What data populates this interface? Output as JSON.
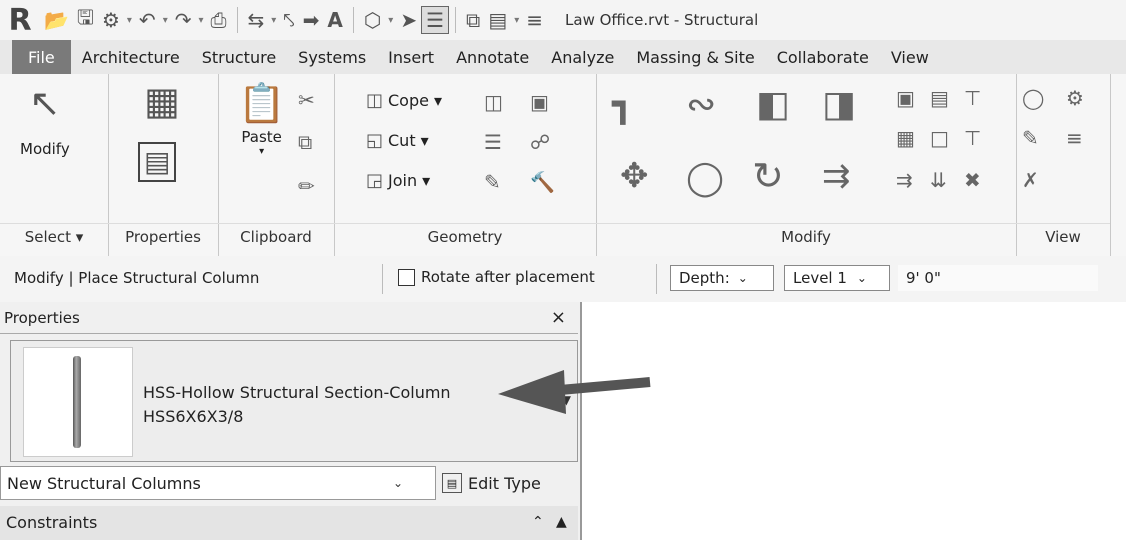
{
  "app": {
    "logo": "R",
    "title": "Law Office.rvt - Structural"
  },
  "qat": {
    "icons": [
      "open-icon",
      "save-icon",
      "sync-icon",
      "undo-icon",
      "redo-icon",
      "print-icon",
      "measure-icon",
      "dimension-icon",
      "tag-icon",
      "text-icon",
      "3d-view-icon",
      "section-icon",
      "thin-lines-icon",
      "close-windows-icon",
      "switch-windows-icon",
      "customize-icon"
    ]
  },
  "tabs": [
    "File",
    "Architecture",
    "Structure",
    "Systems",
    "Insert",
    "Annotate",
    "Analyze",
    "Massing & Site",
    "Collaborate",
    "View"
  ],
  "ribbon": {
    "select": {
      "modify_label": "Modify",
      "panel_label": "Select ▾"
    },
    "properties": {
      "panel_label": "Properties"
    },
    "clipboard": {
      "paste_label": "Paste",
      "panel_label": "Clipboard"
    },
    "geometry": {
      "cope_label": "Cope ▾",
      "cut_label": "Cut ▾",
      "join_label": "Join ▾",
      "panel_label": "Geometry"
    },
    "modify": {
      "panel_label": "Modify"
    },
    "view": {
      "panel_label": "View"
    }
  },
  "options_bar": {
    "context": "Modify | Place Structural Column",
    "rotate_label": "Rotate after placement",
    "depth_label": "Depth:",
    "level_value": "Level 1",
    "height_value": "9'  0\""
  },
  "properties": {
    "header": "Properties",
    "close": "×",
    "type_family": "HSS-Hollow Structural Section-Column",
    "type_size": "HSS6X6X3/8",
    "instance_label": "New Structural Columns",
    "edit_type_label": "Edit Type",
    "section_label": "Constraints"
  },
  "colors": {
    "arrow": "#555555",
    "file_tab": "#7a7a7a"
  }
}
